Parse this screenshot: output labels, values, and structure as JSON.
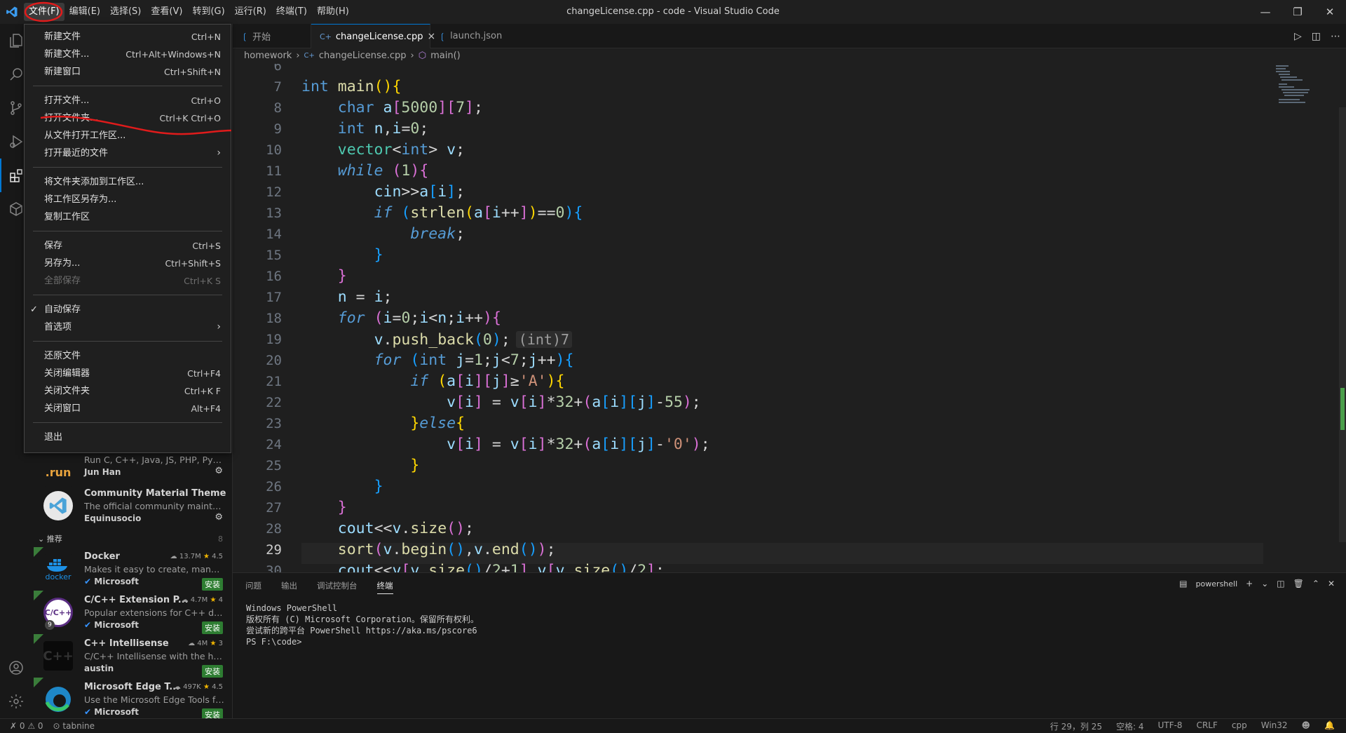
{
  "window": {
    "title": "changeLicense.cpp - code - Visual Studio Code"
  },
  "menubar": {
    "items": [
      "文件(F)",
      "编辑(E)",
      "选择(S)",
      "查看(V)",
      "转到(G)",
      "运行(R)",
      "终端(T)",
      "帮助(H)"
    ]
  },
  "file_menu": {
    "groups": [
      [
        {
          "label": "新建文件",
          "shortcut": "Ctrl+N"
        },
        {
          "label": "新建文件...",
          "shortcut": "Ctrl+Alt+Windows+N"
        },
        {
          "label": "新建窗口",
          "shortcut": "Ctrl+Shift+N"
        }
      ],
      [
        {
          "label": "打开文件...",
          "shortcut": "Ctrl+O"
        },
        {
          "label": "打开文件夹...",
          "shortcut": "Ctrl+K Ctrl+O"
        },
        {
          "label": "从文件打开工作区...",
          "shortcut": ""
        },
        {
          "label": "打开最近的文件",
          "shortcut": "",
          "submenu": true
        }
      ],
      [
        {
          "label": "将文件夹添加到工作区...",
          "shortcut": ""
        },
        {
          "label": "将工作区另存为...",
          "shortcut": ""
        },
        {
          "label": "复制工作区",
          "shortcut": ""
        }
      ],
      [
        {
          "label": "保存",
          "shortcut": "Ctrl+S"
        },
        {
          "label": "另存为...",
          "shortcut": "Ctrl+Shift+S"
        },
        {
          "label": "全部保存",
          "shortcut": "Ctrl+K S",
          "disabled": true
        }
      ],
      [
        {
          "label": "自动保存",
          "shortcut": "",
          "checked": true
        },
        {
          "label": "首选项",
          "shortcut": "",
          "submenu": true
        }
      ],
      [
        {
          "label": "还原文件",
          "shortcut": ""
        },
        {
          "label": "关闭编辑器",
          "shortcut": "Ctrl+F4"
        },
        {
          "label": "关闭文件夹",
          "shortcut": "Ctrl+K F"
        },
        {
          "label": "关闭窗口",
          "shortcut": "Alt+F4"
        }
      ],
      [
        {
          "label": "退出",
          "shortcut": ""
        }
      ]
    ]
  },
  "tabs": [
    {
      "label": "开始",
      "icon": "vscode-icon",
      "active": false
    },
    {
      "label": "changeLicense.cpp",
      "icon": "cpp-icon",
      "active": true,
      "close": "×"
    },
    {
      "label": "launch.json",
      "icon": "vscode-icon",
      "active": false
    }
  ],
  "breadcrumb": {
    "folder": "homework",
    "file": "changeLicense.cpp",
    "symbol": "main()"
  },
  "editor": {
    "line_numbers": [
      "6",
      "7",
      "8",
      "9",
      "10",
      "11",
      "12",
      "13",
      "14",
      "15",
      "16",
      "17",
      "18",
      "19",
      "20",
      "21",
      "22",
      "23",
      "24",
      "25",
      "26",
      "27",
      "28",
      "29",
      "30"
    ],
    "current_line": "29",
    "inlay_hint": "(int)7"
  },
  "sidebar": {
    "run_ext": {
      "logo": ".run",
      "desc": "Run C, C++, Java, JS, PHP, Pytho...",
      "publisher": "Jun Han"
    },
    "material_theme": {
      "name": "Community Material Theme",
      "desc": "The official community maintain...",
      "publisher": "Equinusocio"
    },
    "recommended_label": "推荐",
    "recommended_count": "8",
    "recommended": [
      {
        "name": "Docker",
        "desc": "Makes it easy to create, manage, ...",
        "publisher": "Microsoft",
        "downloads": "13.7M",
        "rating": "4.5",
        "install": "安装",
        "logo_text": "docker",
        "color": "#1d91e6"
      },
      {
        "name": "C/C++ Extension P...",
        "desc": "Popular extensions for C++ deve...",
        "publisher": "Microsoft",
        "downloads": "4.7M",
        "rating": "4",
        "install": "安装",
        "logo_text": "C/C++",
        "badge": "9",
        "color": "#ffffff"
      },
      {
        "name": "C++ Intellisense",
        "desc": "C/C++ Intellisense with the help ...",
        "publisher": "austin",
        "downloads": "4M",
        "rating": "3",
        "install": "安装",
        "logo_text": "C++",
        "color": "#111111"
      },
      {
        "name": "Microsoft Edge T...",
        "desc": "Use the Microsoft Edge Tools fro...",
        "publisher": "Microsoft",
        "downloads": "497K",
        "rating": "4.5",
        "install": "安装",
        "logo_text": "",
        "color": "#1e88c8"
      }
    ]
  },
  "panel": {
    "tabs": [
      "问题",
      "输出",
      "调试控制台",
      "终端"
    ],
    "active_tab": "终端",
    "shell": "powershell",
    "terminal_lines": [
      "Windows PowerShell",
      "版权所有 (C) Microsoft Corporation。保留所有权利。",
      "",
      "尝试新的跨平台 PowerShell https://aka.ms/pscore6",
      "",
      "PS F:\\code>"
    ]
  },
  "statusbar": {
    "errors": "0",
    "warnings": "0",
    "tabnine": "tabnine",
    "position": "行 29，列 25",
    "spaces": "空格: 4",
    "encoding": "UTF-8",
    "eol": "CRLF",
    "language": "cpp",
    "platform": "Win32"
  },
  "colors": {
    "accent": "#0078d4",
    "annotation": "#e01b1b",
    "install_green": "#2e7d32"
  }
}
